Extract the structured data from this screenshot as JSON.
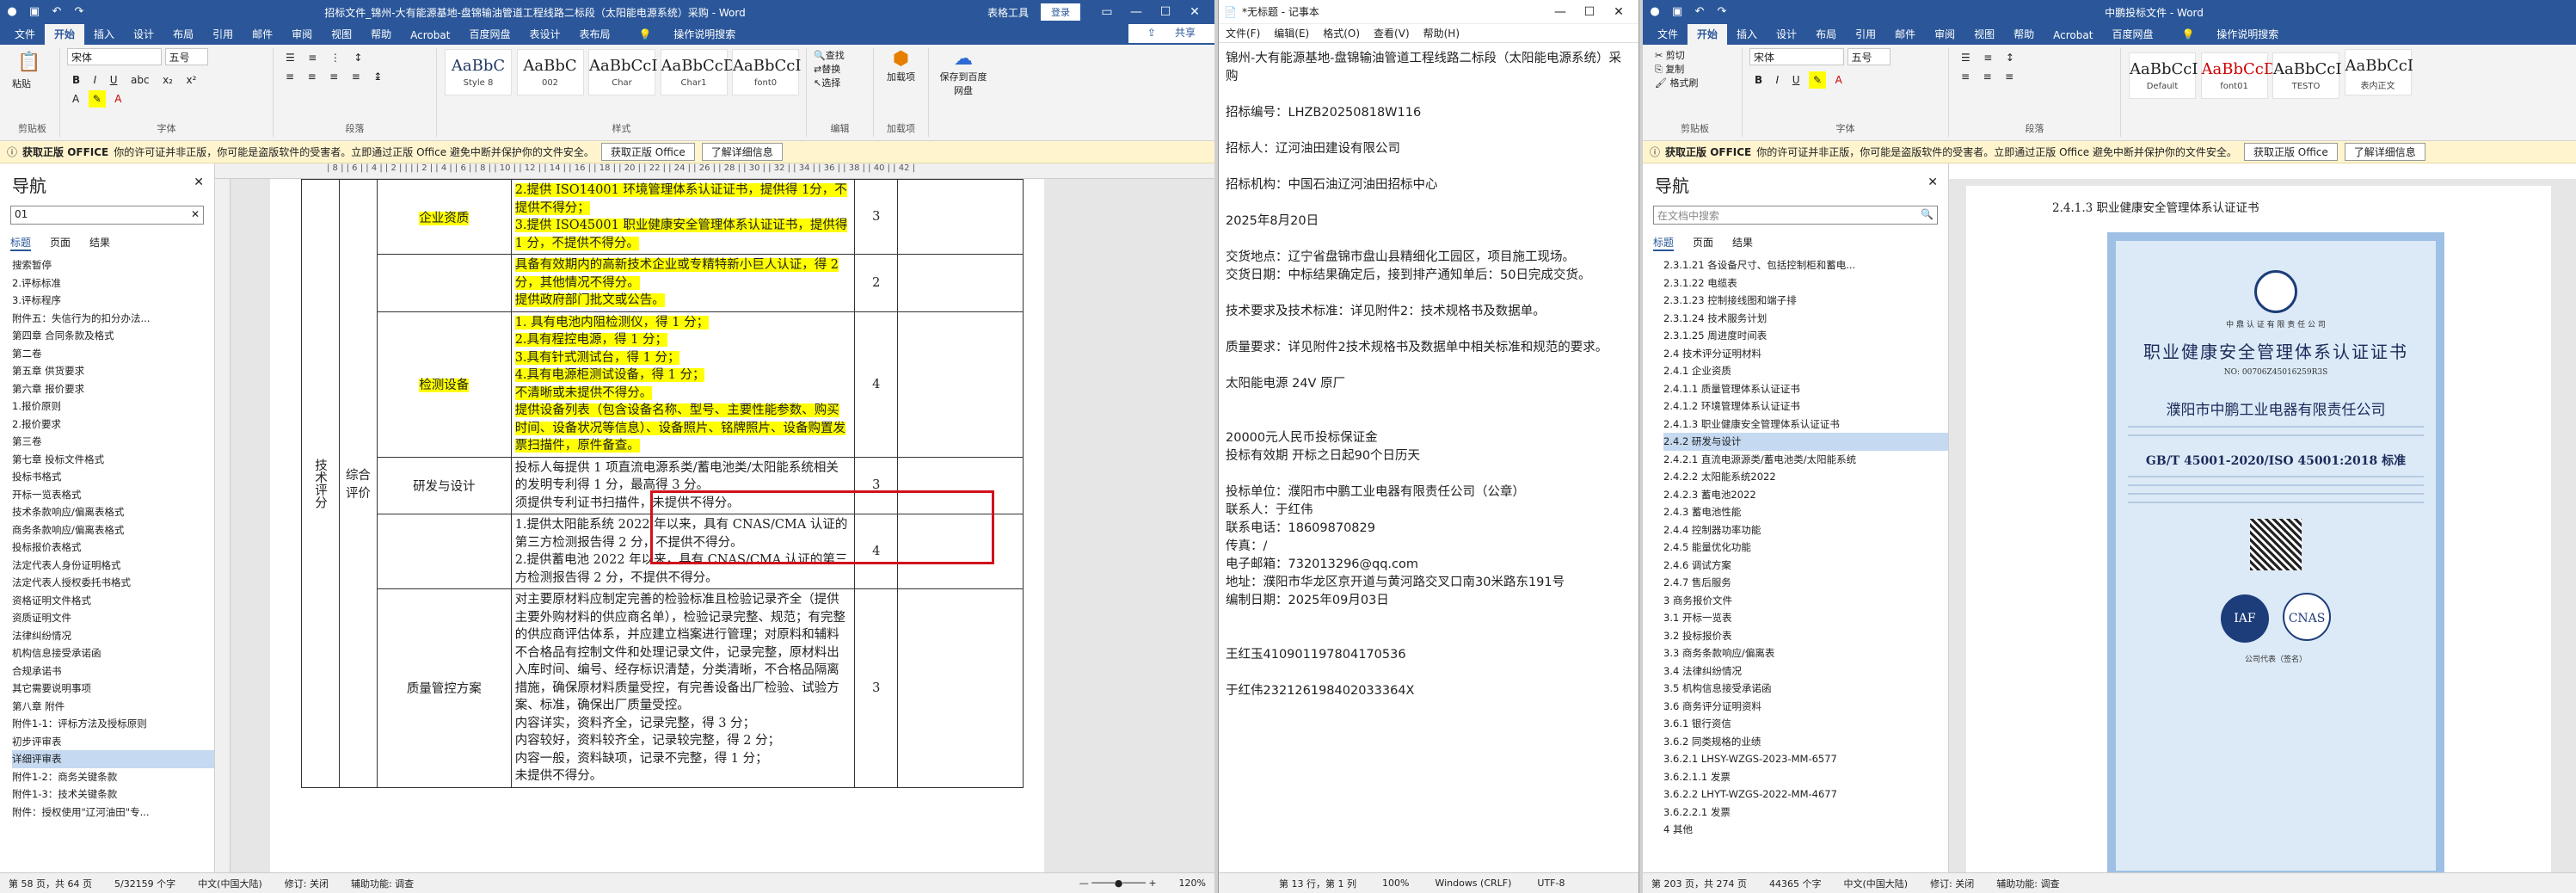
{
  "win1": {
    "title": "招标文件_锦州-大有能源基地-盘锦输油管道工程线路二标段（太阳能电源系统）采购 - Word",
    "login": "登录",
    "context_tab": "表格工具",
    "tabs": [
      "文件",
      "开始",
      "插入",
      "设计",
      "布局",
      "引用",
      "邮件",
      "审阅",
      "视图",
      "帮助",
      "Acrobat",
      "百度网盘",
      "表设计",
      "表布局"
    ],
    "tell_me": "操作说明搜索",
    "share": "共享",
    "ribbon": {
      "font_name": "宋体",
      "font_size": "五号",
      "styles": [
        {
          "sample": "AaBbC",
          "name": "Style 8"
        },
        {
          "sample": "AaBbC",
          "name": "002"
        },
        {
          "sample": "AaBbCcI",
          "name": "Char"
        },
        {
          "sample": "AaBbCcD",
          "name": "Char1"
        },
        {
          "sample": "AaBbCcI",
          "name": "font0"
        }
      ],
      "groups": [
        "剪贴板",
        "字体",
        "段落",
        "样式",
        "编辑",
        "加载项",
        "保存到百度网盘"
      ],
      "edit_items": [
        "查找",
        "替换",
        "选择"
      ],
      "addin": "加载项",
      "save_baidu": "保存到百度网盘",
      "paste": "粘贴"
    },
    "msgbar": {
      "label": "获取正版 OFFICE",
      "text": "你的许可证并非正版，你可能是盗版软件的受害者。立即通过正版 Office 避免中断并保护你的文件安全。",
      "btn1": "获取正版 Office",
      "btn2": "了解详细信息"
    },
    "nav": {
      "title": "导航",
      "search": "01",
      "tabs": [
        "标题",
        "页面",
        "结果"
      ],
      "items": [
        "搜索暂停",
        "2.评标标准",
        "3.评标程序",
        "附件五：失信行为的扣分办法...",
        "第四章 合同条款及格式",
        "第二卷",
        "第五章 供货要求",
        "第六章 报价要求",
        "1.报价原则",
        "2.报价要求",
        "第三卷",
        "第七章 投标文件格式",
        "投标书格式",
        "开标一览表格式",
        "技术条款响应/偏离表格式",
        "商务条款响应/偏离表格式",
        "投标报价表格式",
        "法定代表人身份证明格式",
        "法定代表人授权委托书格式",
        "资格证明文件格式",
        "资质证明文件",
        "法律纠纷情况",
        "机构信息接受承诺函",
        "合规承诺书",
        "其它需要说明事项",
        "第八章 附件",
        "附件1-1：评标方法及授标原则",
        "初步评审表",
        "详细评审表",
        "附件1-2：商务关键条款",
        "附件1-3：技术关键条款",
        "附件：授权使用\"辽河油田\"专..."
      ],
      "selected_index": 28
    },
    "ruler": "| 8 | | 6 | | 4 | | 2 | | | | 2 | | 4 | | 6 | | 8 | | 10 | | 12 | | 14 | | 16 | | 18 | | 20 | | 22 | | 24 | | 26 | | 28 | | 30 | | 32 | | 34 | | 36 | | 38 | | 40 | | 42 |",
    "table": {
      "col1": "技术评分",
      "col2": "综合评价",
      "rows": [
        {
          "item": "企业资质",
          "score": "3",
          "highlight": true,
          "lines": [
            "2.提供 ISO14001 环境管理体系认证证书，提供得 1分，不提供不得分；",
            "3.提供 ISO45001 职业健康安全管理体系认证证书，提供得 1 分，不提供不得分。"
          ]
        },
        {
          "item": "",
          "score": "2",
          "highlight": true,
          "lines": [
            "具备有效期内的高新技术企业或专精特新小巨人认证，得 2 分，其他情况不得分。",
            "提供政府部门批文或公告。"
          ]
        },
        {
          "item": "检测设备",
          "score": "4",
          "highlight": true,
          "lines": [
            "1. 具有电池内阻检测仪，得 1 分；",
            "2.具有程控电源，得 1 分；",
            "3.具有针式测试台，得 1 分；",
            "4.具有电源柜测试设备，得 1 分；",
            "不清晰或未提供不得分。",
            "提供设备列表（包含设备名称、型号、主要性能参数、购买时间、设备状况等信息）、设备照片、铭牌照片、设备购置发票扫描件，原件备查。"
          ]
        },
        {
          "item": "研发与设计",
          "score": "3",
          "highlight": false,
          "lines": [
            "投标人每提供 1 项直流电源系类/蓄电池类/太阳能系统相关的发明专利得 1 分，最高得 3 分。",
            "须提供专利证书扫描件，未提供不得分。"
          ]
        },
        {
          "item": "",
          "score": "4",
          "highlight": false,
          "lines": [
            "1.提供太阳能系统 2022 年以来，具有 CNAS/CMA 认证的第三方检测报告得 2 分，不提供不得分。",
            "2.提供蓄电池 2022 年以来，具有 CNAS/CMA 认证的第三方检测报告得 2 分，不提供不得分。"
          ]
        },
        {
          "item": "质量管控方案",
          "score": "3",
          "highlight": false,
          "lines": [
            "对主要原材料应制定完善的检验标准且检验记录齐全（提供主要外购材料的供应商名单），检验记录完整、规范；有完整的供应商评估体系，并应建立档案进行管理；对原料和辅料不合格品有控制文件和处理记录文件，记录完整，原材料出入库时间、编号、经存标识清楚，分类清晰，不合格品隔离措施，确保原材料质量受控，有完善设备出厂检验、试验方案、标准，确保出厂质量受控。",
            "内容详实，资料齐全，记录完整，得 3 分；",
            "内容较好，资料较齐全，记录较完整，得 2 分；",
            "内容一般，资料缺项，记录不完整，得 1 分；",
            "未提供不得分。"
          ]
        }
      ]
    },
    "status": [
      "第 58 页，共 64 页",
      "5/32159 个字",
      "中文(中国大陆)",
      "修订: 关闭",
      "辅助功能: 调查",
      "120%"
    ]
  },
  "win2": {
    "title": "*无标题 - 记事本",
    "menu": [
      "文件(F)",
      "编辑(E)",
      "格式(O)",
      "查看(V)",
      "帮助(H)"
    ],
    "lines": [
      "锦州-大有能源基地-盘锦输油管道工程线路二标段（太阳能电源系统）采购",
      "",
      "招标编号：LHZB20250818W116",
      "",
      "招标人：辽河油田建设有限公司",
      "",
      "招标机构：中国石油辽河油田招标中心",
      "",
      "2025年8月20日",
      "",
      "交货地点：辽宁省盘锦市盘山县精细化工园区，项目施工现场。",
      "交货日期：中标结果确定后，接到排产通知单后：50日完成交货。",
      "",
      "技术要求及技术标准：详见附件2：技术规格书及数据单。",
      "",
      "质量要求：详见附件2技术规格书及数据单中相关标准和规范的要求。",
      "",
      "太阳能电源 24V 原厂",
      "",
      "",
      "20000元人民币投标保证金",
      "投标有效期  开标之日起90个日历天",
      "",
      "投标单位：濮阳市中鹏工业电器有限责任公司（公章）",
      "联系人：于红伟",
      "联系电话：18609870829",
      "传真：/",
      "电子邮箱：732013296@qq.com",
      "地址：濮阳市华龙区京开道与黄河路交叉口南30米路东191号",
      "编制日期：2025年09月03日",
      "",
      "",
      "王红玉410901197804170536",
      "",
      "于红伟232126198402033364X"
    ],
    "status": [
      "第 13 行，第 1 列",
      "100%",
      "Windows (CRLF)",
      "UTF-8"
    ]
  },
  "win3": {
    "title": "中鹏投标文件 - Word",
    "tabs": [
      "文件",
      "开始",
      "插入",
      "设计",
      "布局",
      "引用",
      "邮件",
      "审阅",
      "视图",
      "帮助",
      "Acrobat",
      "百度网盘"
    ],
    "tell_me": "操作说明搜索",
    "ribbon": {
      "font_name": "宋体",
      "font_size": "五号",
      "styles": [
        {
          "sample": "AaBbCcI",
          "name": "Default"
        },
        {
          "sample": "AaBbCcDd",
          "name": "font01"
        },
        {
          "sample": "AaBbCcI",
          "name": "TESTO"
        },
        {
          "sample": "AaBbCcI",
          "name": "表内正文"
        }
      ],
      "groups": [
        "剪贴板",
        "字体",
        "段落"
      ],
      "clip_items": [
        "剪切",
        "复制",
        "格式刷"
      ]
    },
    "msgbar": {
      "label": "获取正版 OFFICE",
      "text": "你的许可证并非正版，你可能是盗版软件的受害者。立即通过正版 Office 避免中断并保护你的文件安全。",
      "btn1": "获取正版 Office",
      "btn2": "了解详细信息"
    },
    "nav": {
      "title": "导航",
      "search_placeholder": "在文档中搜索",
      "tabs": [
        "标题",
        "页面",
        "结果"
      ],
      "items": [
        "2.3.1.21 各设备尺寸、包括控制柜和蓄电...",
        "2.3.1.22 电缆表",
        "2.3.1.23 控制接线图和端子排",
        "2.3.1.24 技术服务计划",
        "2.3.1.25 周进度时间表",
        "2.4 技术评分证明材料",
        "2.4.1 企业资质",
        "2.4.1.1 质量管理体系认证证书",
        "2.4.1.2 环境管理体系认证证书",
        "2.4.1.3 职业健康安全管理体系认证证书",
        "2.4.2 研发与设计",
        "2.4.2.1 直流电源源类/蓄电池类/太阳能系统",
        "2.4.2.2 太阳能系统2022",
        "2.4.2.3 蓄电池2022",
        "2.4.3 蓄电池性能",
        "2.4.4 控制器功率功能",
        "2.4.5 能量优化功能",
        "2.4.6 调试方案",
        "2.4.7 售后服务",
        "3 商务报价文件",
        "3.1 开标一览表",
        "3.2 投标报价表",
        "3.3 商务条款响应/偏离表",
        "3.4 法律纠纷情况",
        "3.5 机构信息接受承诺函",
        "3.6 商务评分证明资料",
        "3.6.1 银行资信",
        "3.6.2 同类规格的业绩",
        "3.6.2.1 LHSY-WZGS-2023-MM-6577",
        "3.6.2.1.1 发票",
        "3.6.2.2 LHYT-WZGS-2022-MM-4677",
        "3.6.2.2.1 发票",
        "4 其他"
      ],
      "selected_index": 10
    },
    "doc_heading": "2.4.1.3   职业健康安全管理体系认证证书",
    "cert": {
      "org": "中 鼎 认 证 有 限 责 任 公 司",
      "title": "职业健康安全管理体系认证证书",
      "no": "NO: 00706Z45016259R3S",
      "company": "濮阳市中鹏工业电器有限责任公司",
      "standard": "GB/T 45001-2020/ISO 45001:2018  标准",
      "seal_label": "公司代表（签名）"
    },
    "status": [
      "第 203 页，共 274 页",
      "44365 个字",
      "中文(中国大陆)",
      "修订: 关闭",
      "辅助功能: 调查"
    ]
  }
}
